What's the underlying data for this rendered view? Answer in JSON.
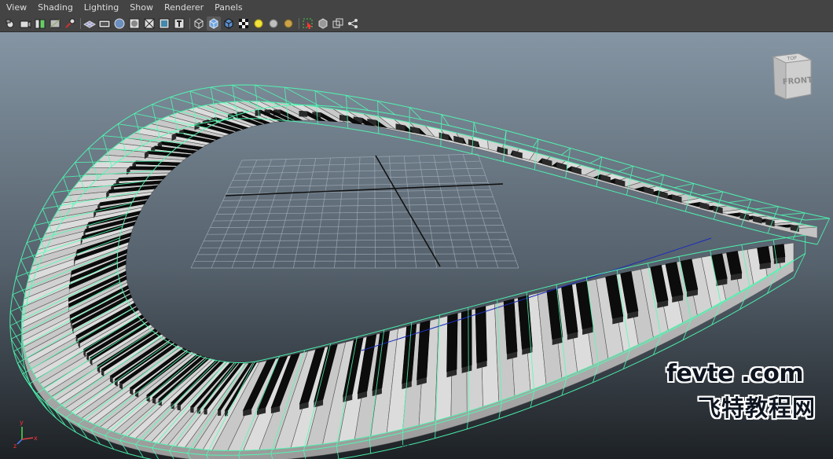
{
  "menu": {
    "items": [
      "View",
      "Shading",
      "Lighting",
      "Show",
      "Renderer",
      "Panels"
    ]
  },
  "toolbar": {
    "groups": [
      [
        "select-camera-icon",
        "camera-attributes-icon",
        "bookmarks-icon",
        "image-plane-icon",
        "two-d-pan-zoom-icon"
      ],
      [
        "grid-icon",
        "film-gate-icon",
        "resolution-gate-icon",
        "gate-mask-icon",
        "field-chart-icon",
        "safe-action-icon",
        "safe-title-icon"
      ],
      [
        "wireframe-icon",
        "smooth-shade-icon",
        "shaded-wireframe-icon",
        "textured-icon",
        "use-all-lights-icon",
        "shadows-icon",
        "screen-space-ao-icon"
      ],
      [
        "isolate-select-icon",
        "xray-icon",
        "xray-joints-icon",
        "xray-components-icon"
      ]
    ],
    "active_tool": "smooth-shade-icon"
  },
  "viewport": {
    "camera": "persp",
    "view_cube_label": "FRONT",
    "view_cube_top_label": "TOP",
    "axis": {
      "x": "x",
      "y": "y",
      "z": "z"
    },
    "colors": {
      "background_top": "#8595a3",
      "background_bottom": "#1d2125",
      "wireframe": "#4dffb4",
      "grid": "#a8b4c0"
    }
  },
  "watermark": {
    "domain": "fevte .com",
    "chinese": "飞特教程网"
  }
}
